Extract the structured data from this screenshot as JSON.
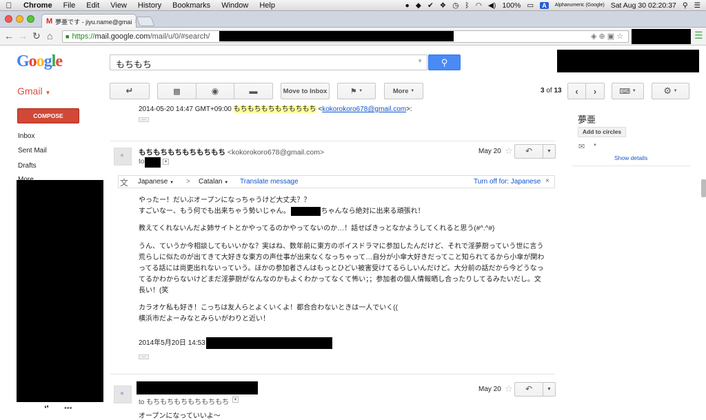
{
  "menubar": {
    "app": "Chrome",
    "items": [
      "File",
      "Edit",
      "View",
      "History",
      "Bookmarks",
      "Window",
      "Help"
    ],
    "battery": "100%",
    "ime_badge": "A",
    "ime": "Alphanumeric (Google)",
    "clock": "Sat Aug 30  02:20:37"
  },
  "browser": {
    "tab_title": "夢亜です - jiyu.name@gmai",
    "url_scheme": "https://",
    "url_host": "mail.google.com",
    "url_path": "/mail/u/0/#search/"
  },
  "gmail": {
    "logo": "Google",
    "search_value": "もちもち",
    "label": "Gmail",
    "compose": "COMPOSE",
    "nav": [
      "Inbox",
      "Sent Mail",
      "Drafts",
      "More"
    ],
    "toolbar": {
      "move_to_inbox": "Move to Inbox",
      "more": "More",
      "page_current": "3",
      "page_of": "of",
      "page_total": "13"
    }
  },
  "thread": {
    "quoted_line": "2014-05-20 14:47 GMT+09:00 ",
    "quoted_name": "もちもちもちもちもちもち",
    "quoted_email": "kokorokoro678@gmail.com",
    "quoted_open": " <",
    "quoted_close": ">:",
    "msg1": {
      "sender": "もちもちもちもちもちもち",
      "email": " <kokorokoro678@gmail.com>",
      "date": "May 20",
      "to": "to"
    },
    "translate": {
      "from": "Japanese",
      "arrow": ">",
      "to": "Catalan",
      "action": "Translate message",
      "turn_off": "Turn off for: Japanese"
    },
    "body": [
      "やったー！だいぶオープンになっちゃうけど大丈夫？？",
      "ちゃんなら絶対に出来る頑張れ！",
      "すごいなー、もう何でも出来ちゃう勢いじゃん。",
      "教えてくれないんだよ姉サイトとかやってるのかやってないのか…！話せばきっとなかようしてくれると思う(#^.^#)",
      "うん、ていうか今相談してもいいかな？実はね、数年前に東方のボイスドラマに参加したんだけど、それで淫夢厨っていう世に言う",
      "荒らしに似たのが出てきて大好きな東方の声仕事が出来なくなっちゃって…自分が小傘大好きだってこと知られてるから小傘が関わ",
      "ってる話には尚更出れないっていう。ほかの参加者さんはもっとひどい被害受けてるらしいんだけど。大分前の話だから今どうなっ",
      "てるかわからないけどまだ淫夢厨がなんなのかもよくわかってなくて怖い；；参加者の個人情報晒し合ったりしてるみたいだし。文",
      "長い！(笑",
      "カラオケ私も好き！こっちは友人らとよくいくよ！都合合わないときは一人でいく((",
      "横浜市だよーみなとみらいがわりと近い！",
      "2014年5月20日 14:53"
    ],
    "msg2": {
      "date": "May 20",
      "to": "to",
      "to_name": "もちもちもちもちもちもち",
      "preview": "オープンになっていいよ〜"
    }
  },
  "contact": {
    "name": "夢亜",
    "add_to_circles": "Add to circles",
    "show_details": "Show details"
  }
}
